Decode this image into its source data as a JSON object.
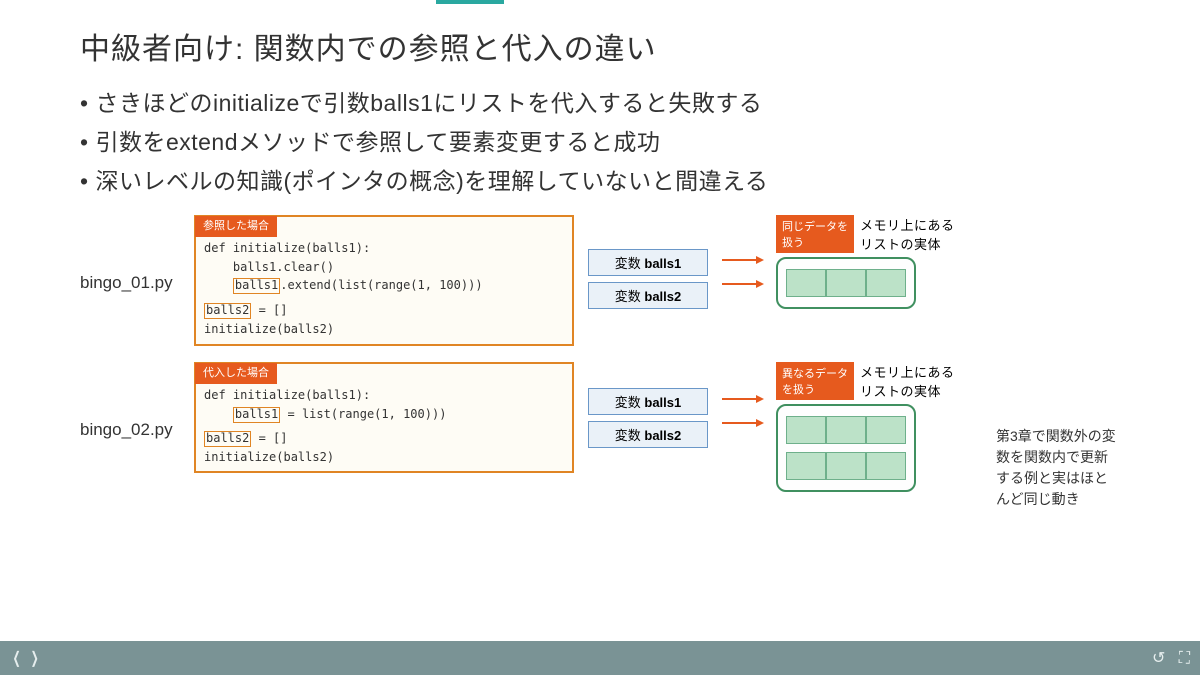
{
  "title": "中級者向け: 関数内での参照と代入の違い",
  "bullets": [
    "さきほどのinitializeで引数balls1にリストを代入すると失敗する",
    "引数をextendメソッドで参照して要素変更すると成功",
    "深いレベルの知識(ポインタの概念)を理解していないと間違える"
  ],
  "fig1": {
    "file": "bingo_01.py",
    "tag": "参照した場合",
    "code_l1": "def initialize(balls1):",
    "code_l2": "    balls1.clear()",
    "code_l3_b": "balls1",
    "code_l3_r": ".extend(list(range(1, 100)))",
    "code_l4_b": "balls2",
    "code_l4_r": " = []",
    "code_l5": "initialize(balls2)",
    "var1": "変数 ",
    "var1b": "balls1",
    "var2": "変数 ",
    "var2b": "balls2",
    "mem_tag": "同じデータを\n扱う",
    "mem_title": "メモリ上にある\nリストの実体"
  },
  "fig2": {
    "file": "bingo_02.py",
    "tag": "代入した場合",
    "code_l1": "def initialize(balls1):",
    "code_l2_b": "balls1",
    "code_l2_r": " = list(range(1, 100)))",
    "code_l3_b": "balls2",
    "code_l3_r": " = []",
    "code_l4": "initialize(balls2)",
    "var1": "変数 ",
    "var1b": "balls1",
    "var2": "変数 ",
    "var2b": "balls2",
    "mem_tag": "異なるデータ\nを扱う",
    "mem_title": "メモリ上にある\nリストの実体"
  },
  "side_note": "第3章で関数外の変数を関数内で更新する例と実はほとんど同じ動き"
}
